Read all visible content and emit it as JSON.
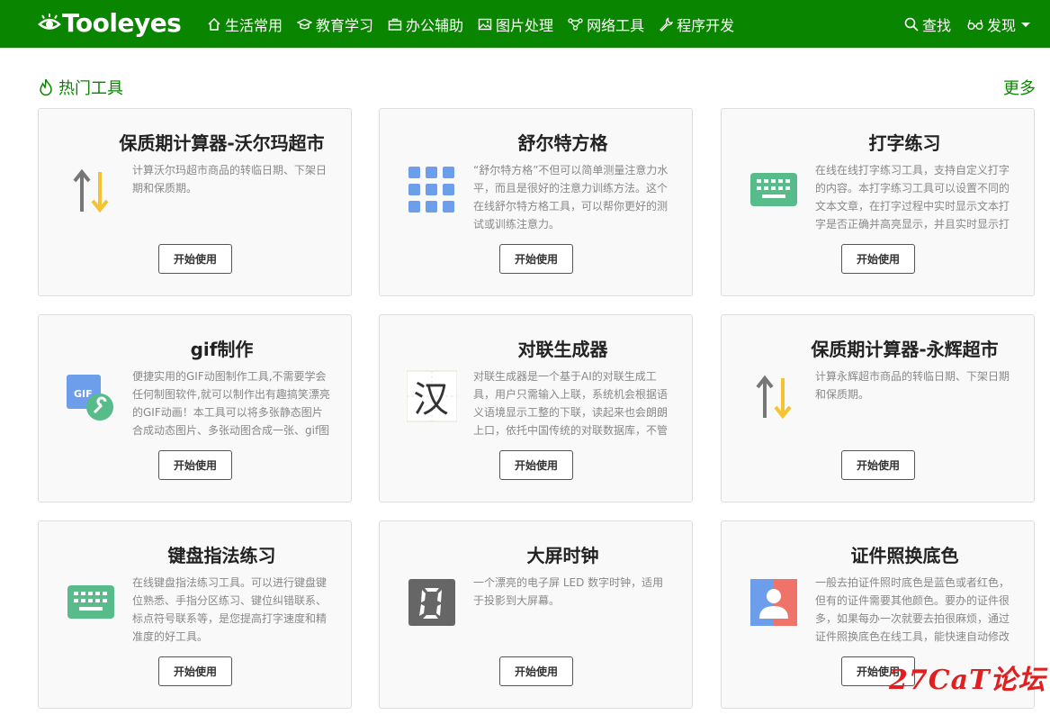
{
  "brand": {
    "logo_text": "Tooleyes"
  },
  "nav": {
    "items": [
      {
        "label": "生活常用",
        "icon": "home-icon"
      },
      {
        "label": "教育学习",
        "icon": "graduation-cap-icon"
      },
      {
        "label": "办公辅助",
        "icon": "briefcase-icon"
      },
      {
        "label": "图片处理",
        "icon": "image-icon"
      },
      {
        "label": "网络工具",
        "icon": "network-icon"
      },
      {
        "label": "程序开发",
        "icon": "wrench-icon"
      }
    ],
    "search_label": "查找",
    "discover_label": "发现"
  },
  "section": {
    "title": "热门工具",
    "more": "更多"
  },
  "cards": [
    {
      "title": "保质期计算器-沃尔玛超市",
      "icon": "arrows-up-down-icon",
      "desc": "计算沃尔玛超市商品的转临日期、下架日期和保质期。",
      "button": "开始使用"
    },
    {
      "title": "舒尔特方格",
      "icon": "grid-dots-icon",
      "desc": "“舒尔特方格”不但可以简单测量注意力水平，而且是很好的注意力训练方法。这个在线舒尔特方格工具，可以帮你更好的测试或训练注意力。",
      "button": "开始使用"
    },
    {
      "title": "打字练习",
      "icon": "keyboard-icon",
      "desc": "在线在线打字练习工具，支持自定义打字的内容。本打字练习工具可以设置不同的文本文章，在打字过程中实时显示文本打字是否正确并高亮显示，并且实时显示打",
      "button": "开始使用"
    },
    {
      "title": "gif制作",
      "icon": "gif-tool-icon",
      "desc": "便捷实用的GIF动图制作工具,不需要学会任何制图软件,就可以制作出有趣搞笑漂亮的GIF动画！本工具可以将多张静态图片合成动态图片、多张动图合成一张、gif图",
      "button": "开始使用"
    },
    {
      "title": "对联生成器",
      "icon": "han-character-icon",
      "desc": "对联生成器是一个基于AI的对联生成工具，用户只需输入上联，系统机会根据语义语境显示工整的下联，读起来也会朗朗上口，依托中国传统的对联数据库，不管",
      "button": "开始使用"
    },
    {
      "title": "保质期计算器-永辉超市",
      "icon": "arrows-up-down-icon",
      "desc": "计算永辉超市商品的转临日期、下架日期和保质期。",
      "button": "开始使用"
    },
    {
      "title": "键盘指法练习",
      "icon": "keyboard-icon",
      "desc": "在线键盘指法练习工具。可以进行键盘键位熟悉、手指分区练习、键位纠错联系、标点符号联系等，是您提高打字速度和精准度的好工具。",
      "button": "开始使用"
    },
    {
      "title": "大屏时钟",
      "icon": "digital-zero-icon",
      "desc": "一个漂亮的电子屏 LED 数字时钟，适用于投影到大屏幕。",
      "button": "开始使用"
    },
    {
      "title": "证件照换底色",
      "icon": "id-photo-icon",
      "desc": "一般去拍证件照时底色是蓝色或者红色，但有的证件需要其他颜色。要办的证件很多，如果每办一次就要去拍很麻烦，通过证件照换底色在线工具，能快速自动修改",
      "button": "开始使用"
    }
  ],
  "watermark": "27CaT论坛",
  "colors": {
    "brand_green": "#0a8500",
    "card_bg": "#f9f9f9"
  }
}
